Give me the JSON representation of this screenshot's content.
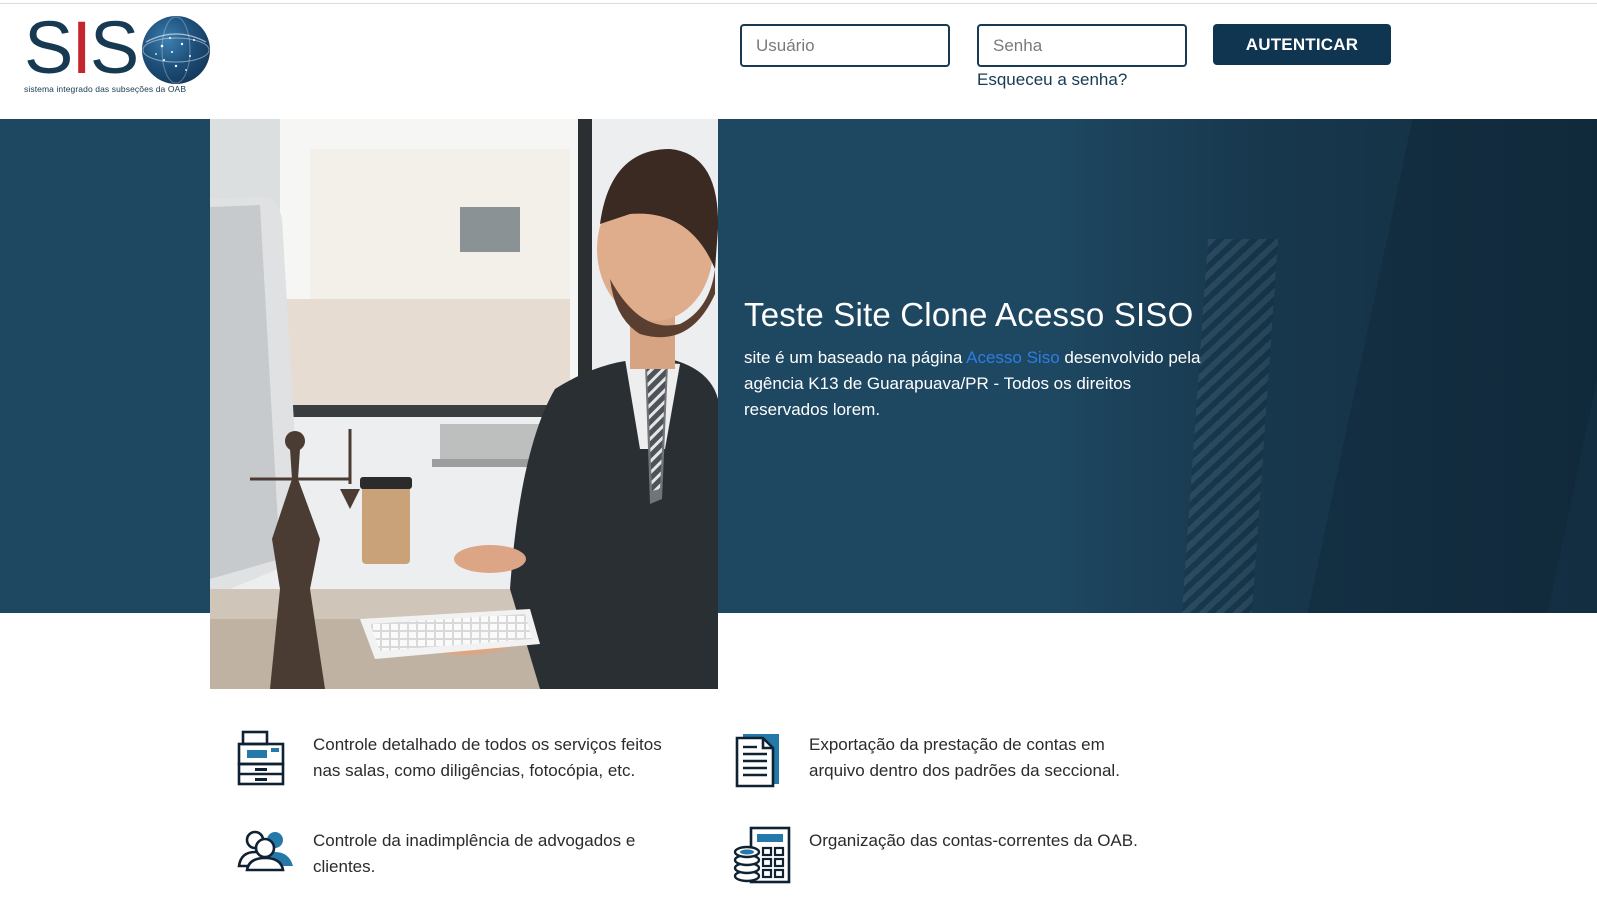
{
  "brand": {
    "logo_letters": "SISO",
    "subtitle": "sistema integrado das subseções da OAB"
  },
  "login": {
    "user_placeholder": "Usuário",
    "password_placeholder": "Senha",
    "forgot_label": "Esqueceu a senha?",
    "submit_label": "AUTENTICAR"
  },
  "hero": {
    "title": "Teste Site Clone Acesso SISO",
    "text_before": "site é um baseado na página ",
    "link_label": "Acesso Siso",
    "text_after": " desenvolvido pela agência K13 de Guarapuava/PR - Todos os direitos reservados lorem."
  },
  "features": [
    {
      "icon": "copier-icon",
      "text": "Controle detalhado de todos os serviços feitos nas salas, como diligências, fotocópia, etc."
    },
    {
      "icon": "document-icon",
      "text": "Exportação da prestação de contas em arquivo dentro dos padrões da seccional."
    },
    {
      "icon": "users-icon",
      "text": "Controle da inadimplência de advogados e clientes."
    },
    {
      "icon": "calculator-coins-icon",
      "text": "Organização das contas-correntes da OAB."
    }
  ],
  "colors": {
    "primary": "#173a52",
    "hero_bg": "#1e4862",
    "logo_red": "#c3262e",
    "link": "#2f7de1"
  }
}
